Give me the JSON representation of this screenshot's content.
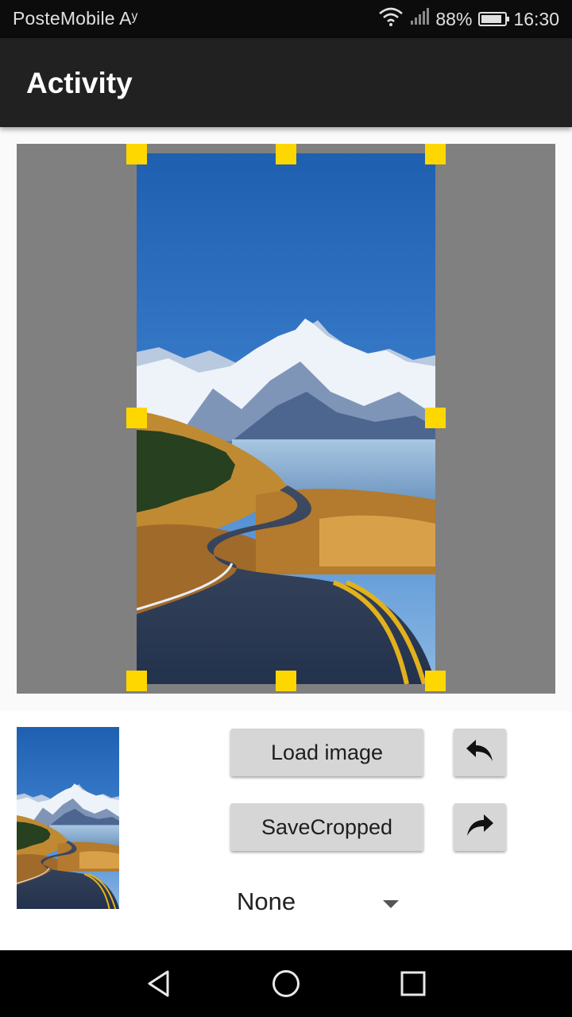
{
  "status_bar": {
    "carrier": "PosteMobile Aʸ",
    "battery_percent": "88%",
    "battery_level": 0.88,
    "time": "16:30",
    "icons": [
      "wifi-icon",
      "signal-icon",
      "battery-icon"
    ]
  },
  "app_bar": {
    "title": "Activity"
  },
  "crop_view": {
    "image": "mountain-road-landscape",
    "handle_color": "#ffd700",
    "background_color": "#808080"
  },
  "controls": {
    "load_label": "Load image",
    "save_label": "SaveCropped",
    "undo_icon": "undo-arrow-icon",
    "redo_icon": "redo-arrow-icon",
    "spinner_value": "None"
  },
  "nav_bar": {
    "icons": [
      "back-triangle-icon",
      "home-circle-icon",
      "recents-square-icon"
    ]
  }
}
